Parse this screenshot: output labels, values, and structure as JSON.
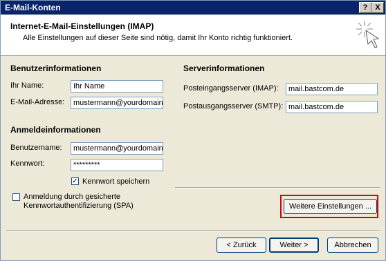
{
  "window": {
    "title": "E-Mail-Konten",
    "help_label": "?",
    "close_label": "X"
  },
  "header": {
    "title": "Internet-E-Mail-Einstellungen (IMAP)",
    "subtitle": "Alle Einstellungen auf dieser Seite sind nötig, damit Ihr Konto richtig funktioniert.",
    "icon": "wizard-sparkle-icon"
  },
  "user_info": {
    "heading": "Benutzerinformationen",
    "name_label": "Ihr Name:",
    "name_value": "Ihr Name",
    "email_label": "E-Mail-Adresse:",
    "email_value": "mustermann@yourdomain.de"
  },
  "login_info": {
    "heading": "Anmeldeinformationen",
    "username_label": "Benutzername:",
    "username_value": "mustermann@yourdomain.de",
    "password_label": "Kennwort:",
    "password_value": "*********",
    "remember_label": "Kennwort speichern",
    "remember_checked": true,
    "spa_label_line1": "Anmeldung durch gesicherte",
    "spa_label_line2": "Kennwortauthentifizierung (SPA)",
    "spa_checked": false
  },
  "server_info": {
    "heading": "Serverinformationen",
    "incoming_label": "Posteingangsserver (IMAP):",
    "incoming_value": "mail.bastcom.de",
    "outgoing_label": "Postausgangsserver (SMTP):",
    "outgoing_value": "mail.bastcom.de"
  },
  "buttons": {
    "more_settings": "Weitere Einstellungen ...",
    "back": "< Zurück",
    "next": "Weiter >",
    "cancel": "Abbrechen"
  },
  "colors": {
    "highlight": "#d8000c",
    "title_bar": "#0a246a"
  }
}
